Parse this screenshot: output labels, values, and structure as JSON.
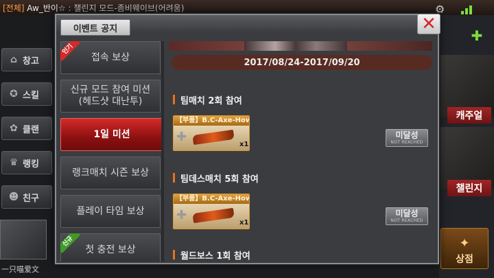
{
  "topbar": {
    "chat_tag": "[전체]",
    "chat_name": "Aw_반이☆",
    "chat_msg": " : 챌린지 모드-좀비웨이브(어려움)"
  },
  "left_menu": {
    "items": [
      {
        "label": "창고",
        "icon": "warehouse-icon",
        "glyph": "⌂"
      },
      {
        "label": "스킬",
        "icon": "skill-icon",
        "glyph": "✪"
      },
      {
        "label": "클랜",
        "icon": "clan-icon",
        "glyph": "✿"
      },
      {
        "label": "랭킹",
        "icon": "trophy-icon",
        "glyph": "♛"
      },
      {
        "label": "친구",
        "icon": "friend-icon",
        "glyph": "☻"
      }
    ],
    "profile_name": "一只喵爱文"
  },
  "right_panel": {
    "casual_label": "캐주얼",
    "challenge_label": "챌린지",
    "shop_label": "상점",
    "shop_icon_glyph": "✦",
    "gamepad_glyph": "✚",
    "gear_glyph": "⚙"
  },
  "modal": {
    "title": "이벤트 공지",
    "close_glyph": "✕",
    "sidebar": [
      {
        "line1": "접속 보상",
        "line2": "",
        "ribbon": "인기",
        "ribbon_type": "hot",
        "active": false
      },
      {
        "line1": "신규 모드 참여 미션",
        "line2": "(헤드샷 대난투)",
        "ribbon": "",
        "ribbon_type": "",
        "active": false
      },
      {
        "line1": "1일 미션",
        "line2": "",
        "ribbon": "",
        "ribbon_type": "",
        "active": true
      },
      {
        "line1": "랭크매치 시즌 보상",
        "line2": "",
        "ribbon": "",
        "ribbon_type": "",
        "active": false
      },
      {
        "line1": "플레이 타임 보상",
        "line2": "",
        "ribbon": "",
        "ribbon_type": "",
        "active": false
      },
      {
        "line1": "첫 충전 보상",
        "line2": "",
        "ribbon": "신규",
        "ribbon_type": "new",
        "active": false
      }
    ],
    "date_range": "2017/08/24-2017/09/20",
    "missions": [
      {
        "title": "팀매치 2회 참여",
        "reward_name": "【부품】B.C-Axe-Howl",
        "reward_qty": "x1",
        "status_main": "미달성",
        "status_sub": "NOT REACHED"
      },
      {
        "title": "팀데스매치 5회 참여",
        "reward_name": "【부품】B.C-Axe-Howl",
        "reward_qty": "x1",
        "status_main": "미달성",
        "status_sub": "NOT REACHED"
      },
      {
        "title": "월드보스 1회 참여"
      }
    ]
  },
  "colors": {
    "accent_red": "#d32a2a",
    "orange_marker": "#e9721c",
    "date_bar": "#582b22",
    "reward_border": "#d99a3a"
  }
}
